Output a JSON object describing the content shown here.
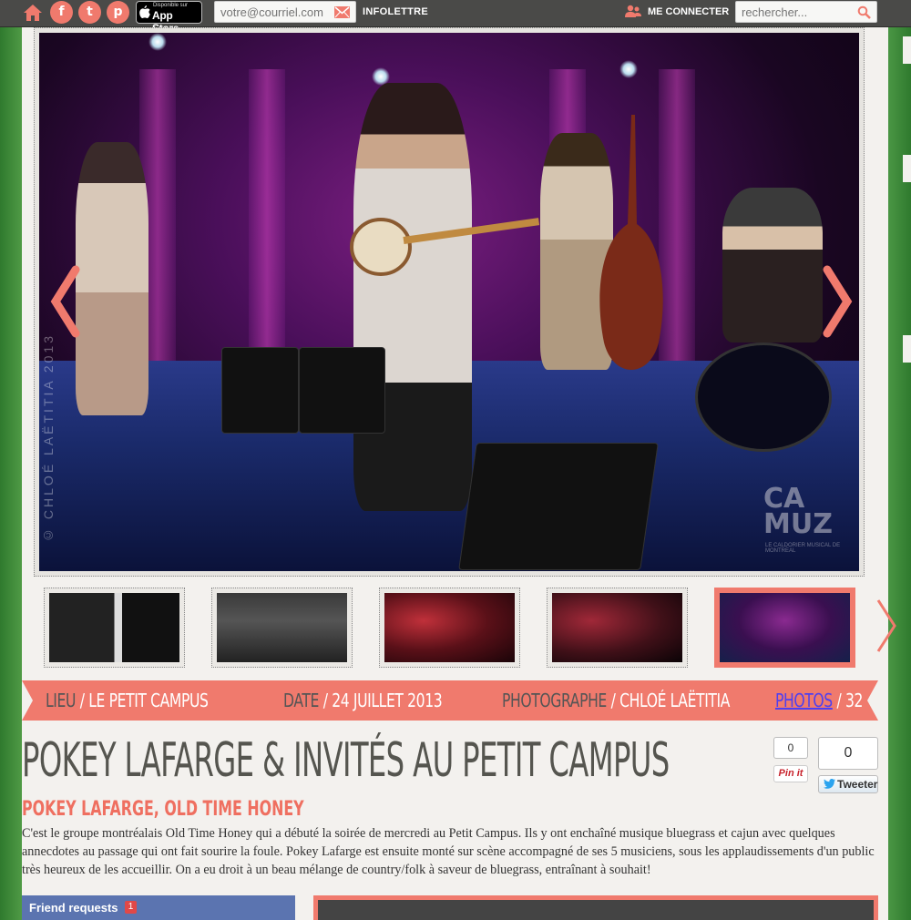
{
  "topbar": {
    "icons": [
      "home-icon",
      "facebook-icon",
      "twitter-icon",
      "pinterest-icon"
    ],
    "appstore_small": "Disponible sur",
    "appstore_big": "App Store",
    "email_placeholder": "votre@courriel.com",
    "newsletter_label": "INFOLETTRE",
    "connect_label": "ME CONNECTER",
    "search_placeholder": "rechercher..."
  },
  "photo": {
    "watermark_vertical": "© CHLOÉ LAËTITIA 2013",
    "watermark_logo_line1": "CA",
    "watermark_logo_line2": "MUZ",
    "watermark_logo_sub": "LE CALDORIER MUSICAL DE MONTREAL"
  },
  "thumbnails": [
    "thumb-poster",
    "thumb-group",
    "thumb-stage-red",
    "thumb-drummer",
    "thumb-band-blue"
  ],
  "info": {
    "venue_label": "LIEU",
    "venue_value": "LE PETIT CAMPUS",
    "date_label": "DATE",
    "date_value": "24 JUILLET 2013",
    "photographer_label": "PHOTOGRAPHE",
    "photographer_value": "CHLOÉ LAËTITIA",
    "photos_label": "PHOTOS",
    "photos_count": "32"
  },
  "article": {
    "title": "POKEY LAFARGE & INVITÉS AU PETIT CAMPUS",
    "artist1": "POKEY LAFARGE",
    "artist2": "OLD TIME HONEY",
    "body": "C'est le groupe montréalais Old Time Honey qui a débuté la soirée de mercredi au Petit Campus. Ils y ont enchaîné musique bluegrass et cajun avec quelques annecdotes au passage qui ont fait sourire la foule. Pokey Lafarge est ensuite monté sur scène accompagné de ses 5 musiciens, sous les applaudissements d'un public très heureux de les accueillir. On a eu droit à un beau mélange de country/folk à saveur de bluegrass, entraînant à souhait!"
  },
  "social": {
    "pin_count": "0",
    "pin_label": "Pin it",
    "tweet_count": "0",
    "tweet_label": "Tweeter"
  },
  "bottom": {
    "friend_requests_label": "Friend requests",
    "friend_requests_count": "1"
  },
  "colors": {
    "accent": "#f07a6d",
    "topbar": "#4a4a48",
    "title": "#55554f",
    "link": "#4f3ff0"
  }
}
